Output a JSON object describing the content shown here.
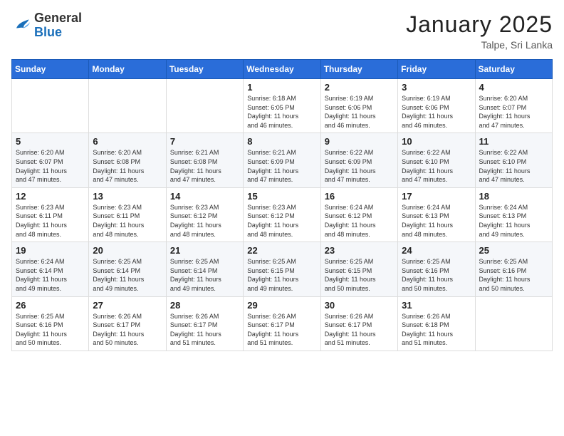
{
  "header": {
    "logo_general": "General",
    "logo_blue": "Blue",
    "month_title": "January 2025",
    "location": "Talpe, Sri Lanka"
  },
  "days_of_week": [
    "Sunday",
    "Monday",
    "Tuesday",
    "Wednesday",
    "Thursday",
    "Friday",
    "Saturday"
  ],
  "weeks": [
    [
      {
        "day": "",
        "content": ""
      },
      {
        "day": "",
        "content": ""
      },
      {
        "day": "",
        "content": ""
      },
      {
        "day": "1",
        "content": "Sunrise: 6:18 AM\nSunset: 6:05 PM\nDaylight: 11 hours\nand 46 minutes."
      },
      {
        "day": "2",
        "content": "Sunrise: 6:19 AM\nSunset: 6:06 PM\nDaylight: 11 hours\nand 46 minutes."
      },
      {
        "day": "3",
        "content": "Sunrise: 6:19 AM\nSunset: 6:06 PM\nDaylight: 11 hours\nand 46 minutes."
      },
      {
        "day": "4",
        "content": "Sunrise: 6:20 AM\nSunset: 6:07 PM\nDaylight: 11 hours\nand 47 minutes."
      }
    ],
    [
      {
        "day": "5",
        "content": "Sunrise: 6:20 AM\nSunset: 6:07 PM\nDaylight: 11 hours\nand 47 minutes."
      },
      {
        "day": "6",
        "content": "Sunrise: 6:20 AM\nSunset: 6:08 PM\nDaylight: 11 hours\nand 47 minutes."
      },
      {
        "day": "7",
        "content": "Sunrise: 6:21 AM\nSunset: 6:08 PM\nDaylight: 11 hours\nand 47 minutes."
      },
      {
        "day": "8",
        "content": "Sunrise: 6:21 AM\nSunset: 6:09 PM\nDaylight: 11 hours\nand 47 minutes."
      },
      {
        "day": "9",
        "content": "Sunrise: 6:22 AM\nSunset: 6:09 PM\nDaylight: 11 hours\nand 47 minutes."
      },
      {
        "day": "10",
        "content": "Sunrise: 6:22 AM\nSunset: 6:10 PM\nDaylight: 11 hours\nand 47 minutes."
      },
      {
        "day": "11",
        "content": "Sunrise: 6:22 AM\nSunset: 6:10 PM\nDaylight: 11 hours\nand 47 minutes."
      }
    ],
    [
      {
        "day": "12",
        "content": "Sunrise: 6:23 AM\nSunset: 6:11 PM\nDaylight: 11 hours\nand 48 minutes."
      },
      {
        "day": "13",
        "content": "Sunrise: 6:23 AM\nSunset: 6:11 PM\nDaylight: 11 hours\nand 48 minutes."
      },
      {
        "day": "14",
        "content": "Sunrise: 6:23 AM\nSunset: 6:12 PM\nDaylight: 11 hours\nand 48 minutes."
      },
      {
        "day": "15",
        "content": "Sunrise: 6:23 AM\nSunset: 6:12 PM\nDaylight: 11 hours\nand 48 minutes."
      },
      {
        "day": "16",
        "content": "Sunrise: 6:24 AM\nSunset: 6:12 PM\nDaylight: 11 hours\nand 48 minutes."
      },
      {
        "day": "17",
        "content": "Sunrise: 6:24 AM\nSunset: 6:13 PM\nDaylight: 11 hours\nand 48 minutes."
      },
      {
        "day": "18",
        "content": "Sunrise: 6:24 AM\nSunset: 6:13 PM\nDaylight: 11 hours\nand 49 minutes."
      }
    ],
    [
      {
        "day": "19",
        "content": "Sunrise: 6:24 AM\nSunset: 6:14 PM\nDaylight: 11 hours\nand 49 minutes."
      },
      {
        "day": "20",
        "content": "Sunrise: 6:25 AM\nSunset: 6:14 PM\nDaylight: 11 hours\nand 49 minutes."
      },
      {
        "day": "21",
        "content": "Sunrise: 6:25 AM\nSunset: 6:14 PM\nDaylight: 11 hours\nand 49 minutes."
      },
      {
        "day": "22",
        "content": "Sunrise: 6:25 AM\nSunset: 6:15 PM\nDaylight: 11 hours\nand 49 minutes."
      },
      {
        "day": "23",
        "content": "Sunrise: 6:25 AM\nSunset: 6:15 PM\nDaylight: 11 hours\nand 50 minutes."
      },
      {
        "day": "24",
        "content": "Sunrise: 6:25 AM\nSunset: 6:16 PM\nDaylight: 11 hours\nand 50 minutes."
      },
      {
        "day": "25",
        "content": "Sunrise: 6:25 AM\nSunset: 6:16 PM\nDaylight: 11 hours\nand 50 minutes."
      }
    ],
    [
      {
        "day": "26",
        "content": "Sunrise: 6:25 AM\nSunset: 6:16 PM\nDaylight: 11 hours\nand 50 minutes."
      },
      {
        "day": "27",
        "content": "Sunrise: 6:26 AM\nSunset: 6:17 PM\nDaylight: 11 hours\nand 50 minutes."
      },
      {
        "day": "28",
        "content": "Sunrise: 6:26 AM\nSunset: 6:17 PM\nDaylight: 11 hours\nand 51 minutes."
      },
      {
        "day": "29",
        "content": "Sunrise: 6:26 AM\nSunset: 6:17 PM\nDaylight: 11 hours\nand 51 minutes."
      },
      {
        "day": "30",
        "content": "Sunrise: 6:26 AM\nSunset: 6:17 PM\nDaylight: 11 hours\nand 51 minutes."
      },
      {
        "day": "31",
        "content": "Sunrise: 6:26 AM\nSunset: 6:18 PM\nDaylight: 11 hours\nand 51 minutes."
      },
      {
        "day": "",
        "content": ""
      }
    ]
  ]
}
